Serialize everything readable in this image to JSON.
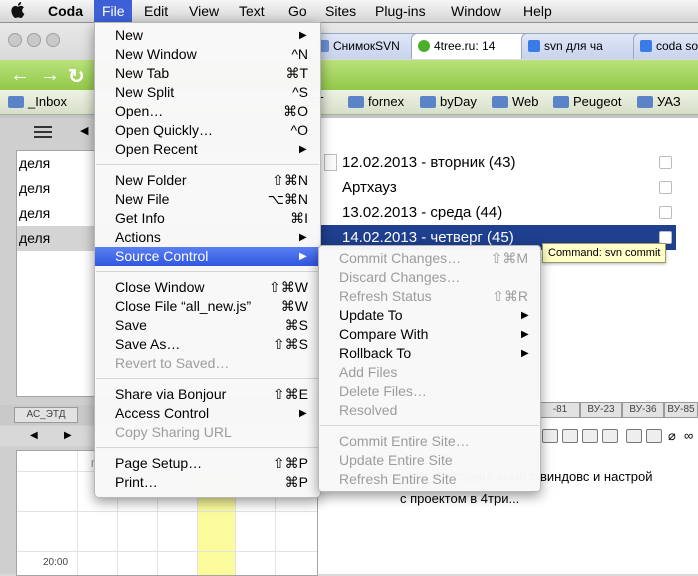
{
  "menubar": {
    "apple_icon": "apple-logo",
    "app": "Coda",
    "items": [
      "File",
      "Edit",
      "View",
      "Text",
      "Go",
      "Sites",
      "Plug-ins",
      "Window",
      "Help"
    ]
  },
  "browser": {
    "tabs": [
      "СнимокSVN",
      "4tree.ru: 14",
      "svn для ча",
      "coda so"
    ],
    "bookmarks": [
      "_Inbox",
      "ST",
      "fornex",
      "byDay",
      "Web",
      "Peugeot",
      "УАЗ"
    ]
  },
  "left_list": {
    "rows": [
      "деля",
      "деля",
      "деля",
      "деля"
    ]
  },
  "calendar": {
    "tabs": [
      "АС_ЭТД"
    ],
    "day_header": "Пн",
    "time_label": "20:00"
  },
  "right_list": {
    "rows": [
      "12.02.2013 - вторник (43)",
      "Артхауз",
      "13.02.2013 - среда (44)",
      "14.02.2013 - четверг (45)"
    ],
    "tabs": [
      "-81",
      "ВУ-23",
      "ВУ-36",
      "ВУ-85"
    ],
    "body_line1": "пьютер. Поставил комп с виндовс и настрой",
    "body_line2": "с проектом в 4три..."
  },
  "tooltip": "Command: svn commit",
  "file_menu": {
    "items": [
      {
        "label": "New",
        "shortcut": "",
        "arrow": true,
        "disabled": false
      },
      {
        "label": "New Window",
        "shortcut": "^N",
        "arrow": false,
        "disabled": false
      },
      {
        "label": "New Tab",
        "shortcut": "⌘T",
        "arrow": false,
        "disabled": false
      },
      {
        "label": "New Split",
        "shortcut": "^S",
        "arrow": false,
        "disabled": false
      },
      {
        "label": "Open…",
        "shortcut": "⌘O",
        "arrow": false,
        "disabled": false
      },
      {
        "label": "Open Quickly…",
        "shortcut": "^O",
        "arrow": false,
        "disabled": false
      },
      {
        "label": "Open Recent",
        "shortcut": "",
        "arrow": true,
        "disabled": false
      },
      {
        "label": "New Folder",
        "shortcut": "⇧⌘N",
        "arrow": false,
        "disabled": false
      },
      {
        "label": "New File",
        "shortcut": "⌥⌘N",
        "arrow": false,
        "disabled": false
      },
      {
        "label": "Get Info",
        "shortcut": "⌘I",
        "arrow": false,
        "disabled": false
      },
      {
        "label": "Actions",
        "shortcut": "",
        "arrow": true,
        "disabled": false
      },
      {
        "label": "Source Control",
        "shortcut": "",
        "arrow": true,
        "disabled": false
      },
      {
        "label": "Close Window",
        "shortcut": "⇧⌘W",
        "arrow": false,
        "disabled": false
      },
      {
        "label": "Close File “all_new.js”",
        "shortcut": "⌘W",
        "arrow": false,
        "disabled": false
      },
      {
        "label": "Save",
        "shortcut": "⌘S",
        "arrow": false,
        "disabled": false
      },
      {
        "label": "Save As…",
        "shortcut": "⇧⌘S",
        "arrow": false,
        "disabled": false
      },
      {
        "label": "Revert to Saved…",
        "shortcut": "",
        "arrow": false,
        "disabled": true
      },
      {
        "label": "Share via Bonjour",
        "shortcut": "⇧⌘E",
        "arrow": false,
        "disabled": false
      },
      {
        "label": "Access Control",
        "shortcut": "",
        "arrow": true,
        "disabled": false
      },
      {
        "label": "Copy Sharing URL",
        "shortcut": "",
        "arrow": false,
        "disabled": true
      },
      {
        "label": "Page Setup…",
        "shortcut": "⇧⌘P",
        "arrow": false,
        "disabled": false
      },
      {
        "label": "Print…",
        "shortcut": "⌘P",
        "arrow": false,
        "disabled": false
      }
    ]
  },
  "source_control_menu": {
    "items": [
      {
        "label": "Commit Changes…",
        "shortcut": "⇧⌘M",
        "arrow": false,
        "disabled": true
      },
      {
        "label": "Discard Changes…",
        "shortcut": "",
        "arrow": false,
        "disabled": true
      },
      {
        "label": "Refresh Status",
        "shortcut": "⇧⌘R",
        "arrow": false,
        "disabled": true
      },
      {
        "label": "Update To",
        "shortcut": "",
        "arrow": true,
        "disabled": false
      },
      {
        "label": "Compare With",
        "shortcut": "",
        "arrow": true,
        "disabled": false
      },
      {
        "label": "Rollback To",
        "shortcut": "",
        "arrow": true,
        "disabled": false
      },
      {
        "label": "Add Files",
        "shortcut": "",
        "arrow": false,
        "disabled": true
      },
      {
        "label": "Delete Files…",
        "shortcut": "",
        "arrow": false,
        "disabled": true
      },
      {
        "label": "Resolved",
        "shortcut": "",
        "arrow": false,
        "disabled": true
      },
      {
        "label": "Commit Entire Site…",
        "shortcut": "",
        "arrow": false,
        "disabled": true
      },
      {
        "label": "Update Entire Site",
        "shortcut": "",
        "arrow": false,
        "disabled": true
      },
      {
        "label": "Refresh Entire Site",
        "shortcut": "",
        "arrow": false,
        "disabled": true
      }
    ]
  },
  "colors": {
    "menu_highlight": "#3d60d6",
    "selection": "#1f3f8f",
    "browser_green": "#9ccf57",
    "calendar_highlight": "#fbfb9c"
  }
}
